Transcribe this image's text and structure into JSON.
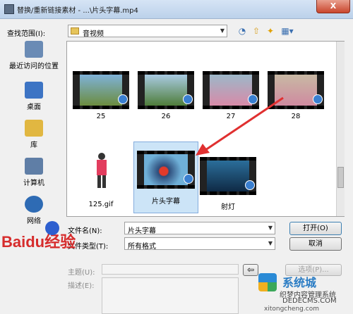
{
  "title": "替换/重新链接素材 - ...\\片头字幕.mp4",
  "close_label": "X",
  "lookin": {
    "label": "查找范围(I):",
    "folder": "音视频"
  },
  "toolbar": {
    "back": "◔",
    "up": "⇧",
    "newfolder": "✦",
    "view": "▦▾"
  },
  "places": [
    {
      "label": "最近访问的位置",
      "icon": "recent-places-icon",
      "color": "#6a8bb5"
    },
    {
      "label": "桌面",
      "icon": "desktop-icon",
      "color": "#3d74c4"
    },
    {
      "label": "库",
      "icon": "libraries-icon",
      "color": "#e1b741"
    },
    {
      "label": "计算机",
      "icon": "computer-icon",
      "color": "#5f7ea6"
    },
    {
      "label": "网络",
      "icon": "network-icon",
      "color": "#2e6bb4"
    }
  ],
  "files": [
    {
      "name": "25",
      "kind": "video"
    },
    {
      "name": "26",
      "kind": "video"
    },
    {
      "name": "27",
      "kind": "video"
    },
    {
      "name": "28",
      "kind": "video"
    },
    {
      "name": "125.gif",
      "kind": "image"
    },
    {
      "name": "片头字幕",
      "kind": "video",
      "selected": true
    },
    {
      "name": "射灯",
      "kind": "video"
    }
  ],
  "filename": {
    "label": "文件名(N):",
    "value": "片头字幕"
  },
  "filetype": {
    "label": "文件类型(T):",
    "value": "所有格式"
  },
  "buttons": {
    "open": "打开(O)",
    "cancel": "取消",
    "options": "选项(P)..."
  },
  "subject": {
    "label": "主题(U):"
  },
  "description": {
    "label": "描述(E):"
  },
  "watermarks": {
    "baidu": "Baidu经验",
    "site1": "织梦内容管理系统",
    "site2": "DEDECMS.COM",
    "site3": "xitongcheng.com",
    "site4": "系统城"
  },
  "colors": {
    "accent": "#cce4f7",
    "arrow": "#e03030",
    "baidu_red": "#d62c2c",
    "baidu_blue": "#2d5fcf"
  }
}
